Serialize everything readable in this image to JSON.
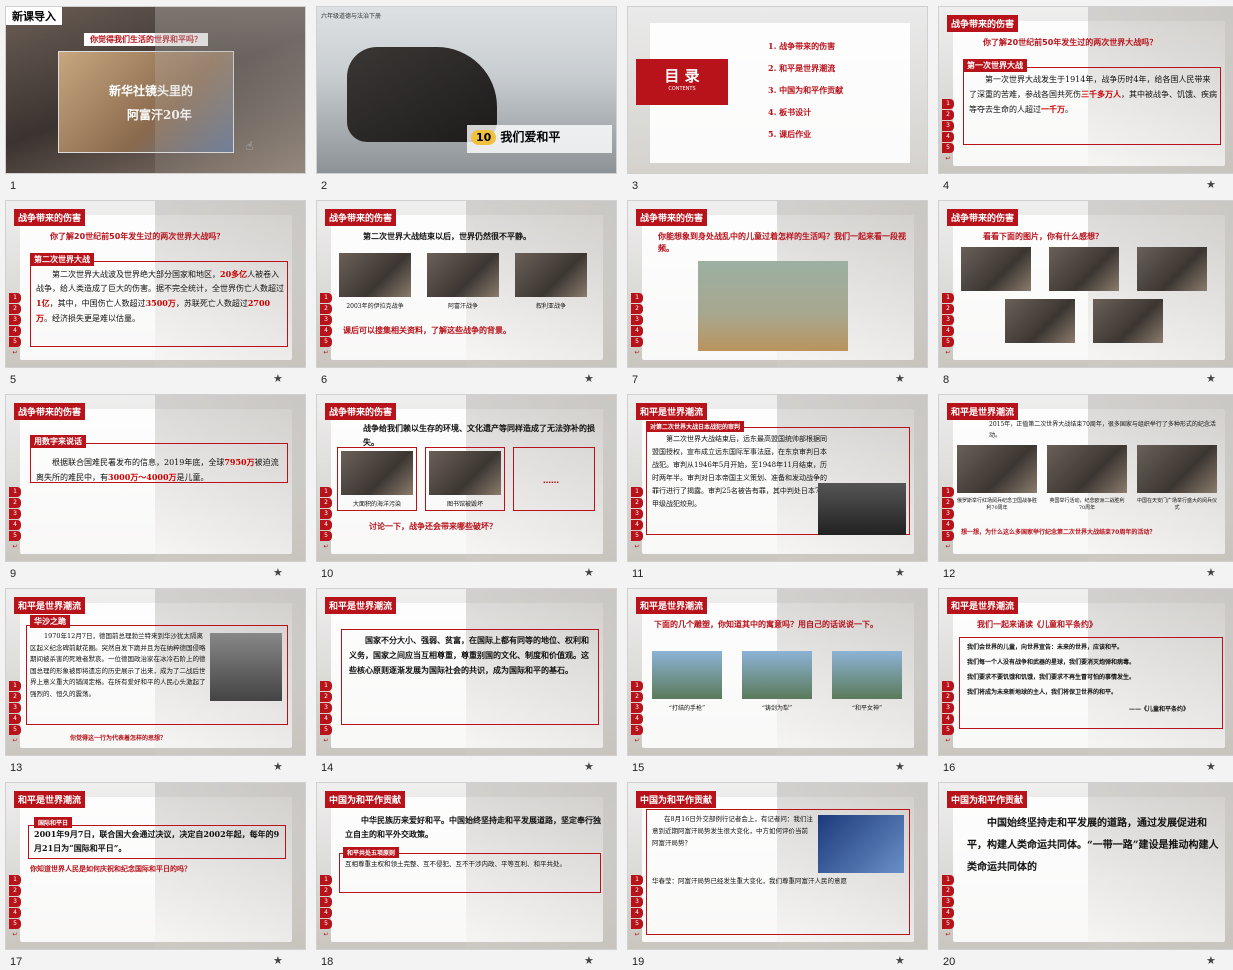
{
  "slides": [
    {
      "num": "1",
      "tag": "新课导入",
      "question": "你觉得我们生活的世界和平吗？",
      "video_line1": "新华社镜头里的",
      "video_line2": "阿富汗20年"
    },
    {
      "num": "2",
      "header": "六年级道德与法治下册",
      "lesson_no": "10",
      "lesson_title": "我们爱和平"
    },
    {
      "num": "3",
      "title": "目 录",
      "subtitle": "CONTENTS",
      "items": [
        "1. 战争带来的伤害",
        "2. 和平是世界潮流",
        "3. 中国为和平作贡献",
        "4. 板书设计",
        "5. 课后作业"
      ]
    },
    {
      "num": "4",
      "tag": "战争带来的伤害",
      "question": "你了解20世纪前50年发生过的两次世界大战吗？",
      "sub": "第一次世界大战",
      "text_a": "第一次世界大战发生于1914年，战争历时4年，给各国人民带来了深重的苦难，参战各国共死伤",
      "hl1": "三千多万人",
      "text_b": "，其中被战争、饥饿、疾病等夺去生命的人超过",
      "hl2": "一千万",
      "text_c": "。"
    },
    {
      "num": "5",
      "tag": "战争带来的伤害",
      "question": "你了解20世纪前50年发生过的两次世界大战吗？",
      "sub": "第二次世界大战",
      "text_a": "第二次世界大战波及世界绝大部分国家和地区，",
      "hl1": "20多亿",
      "text_b": "人被卷入战争，给人类造成了巨大的伤害。据不完全统计，全世界伤亡人数超过",
      "hl2": "1亿",
      "text_c": "，其中，中国伤亡人数超过",
      "hl3": "3500万",
      "text_d": "，苏联死亡人数超过",
      "hl4": "2700万",
      "text_e": "。经济损失更是难以估量。"
    },
    {
      "num": "6",
      "tag": "战争带来的伤害",
      "intro": "第二次世界大战结束以后，世界仍然很不平静。",
      "caps": [
        "2003年的伊拉克战争",
        "阿富汗战争",
        "叙利亚战争"
      ],
      "note": "课后可以搜集相关资料，了解这些战争的背景。"
    },
    {
      "num": "7",
      "tag": "战争带来的伤害",
      "question": "你能想象到身处战乱中的儿童过着怎样的生活吗？我们一起来看一段视频。"
    },
    {
      "num": "8",
      "tag": "战争带来的伤害",
      "question": "看看下面的图片，你有什么感想？"
    },
    {
      "num": "9",
      "tag": "战争带来的伤害",
      "sub": "用数字来说话",
      "text_a": "根据联合国难民署发布的信息，2019年底，全球",
      "hl1": "7950万",
      "text_b": "被迫流离失所的难民中，有",
      "hl2": "3000万～4000万",
      "text_c": "是儿童。"
    },
    {
      "num": "10",
      "tag": "战争带来的伤害",
      "intro": "战争给我们赖以生存的环境、文化遗产等同样造成了无法弥补的损失。",
      "caps": [
        "大面积的海洋污染",
        "图书馆被毁坏"
      ],
      "dots": "……",
      "question": "讨论一下，战争还会带来哪些破坏？"
    },
    {
      "num": "11",
      "tag": "和平是世界潮流",
      "sub": "对第二次世界大战日本战犯的审判",
      "text": "第二次世界大战结束后，远东最高盟国统帅部根据同盟国授权，宣布成立远东国际军事法庭，在东京审判日本战犯。审判从1946年5月开始，至1948年11月结束，历时两年半。审判对日本帝国主义策划、准备和发动战争的罪行进行了揭露。审判25名被告有罪，其中判处日本7名甲级战犯绞刑。"
    },
    {
      "num": "12",
      "tag": "和平是世界潮流",
      "intro": "2015年，正值第二次世界大战结束70周年，很多国家与组织举行了多种形式的纪念活动。",
      "caps": [
        "俄罗斯举行红场阅兵纪念卫国战争胜利70周年",
        "英国举行活动，纪念欧洲二战胜利70周年",
        "中国在天安门广场举行盛大的阅兵仪式"
      ],
      "question": "想一想，为什么这么多国家举行纪念第二次世界大战结束70周年的活动？"
    },
    {
      "num": "13",
      "tag": "和平是世界潮流",
      "sub": "华沙之跪",
      "text": "1970年12月7日，德国前总理勃兰特来到华沙犹太隔离区起义纪念碑前献花圈。突然自发下跪并且为在纳粹德国侵略期间被杀害的死难者默哀。一位德国政治家在冰冷石阶上的德国总理的形象被即将遗忘的历史展示了出来，成为了二战后世界上意义重大的铺阔定格。在所有爱好和平的人民心头激起了强烈的、恒久的震荡。",
      "question": "你觉得这一行为代表着怎样的思想？"
    },
    {
      "num": "14",
      "tag": "和平是世界潮流",
      "text": "国家不分大小、强弱、贫富，在国际上都有同等的地位、权利和义务，国家之间应当互相尊重，尊重别国的文化、制度和价值观。这些核心原则逐渐发展为国际社会的共识，成为国际和平的基石。"
    },
    {
      "num": "15",
      "tag": "和平是世界潮流",
      "question": "下面的几个雕塑，你知道其中的寓意吗？用自己的话说说一下。",
      "caps": [
        "“打结的手枪”",
        "“铸剑为犁”",
        "“和平女神”"
      ]
    },
    {
      "num": "16",
      "tag": "和平是世界潮流",
      "question": "我们一起来诵读《儿童和平条约》",
      "lines": [
        "我们会世界的儿童，向世界宣告：未来的世界，应该和平。",
        "我们每一个人没有战争和武器的星球，我们要消灭炮弹和病毒。",
        "我们要求不要饥饿和饥饿，我们要求不再生冒可怕的事情发生。",
        "我们将成为未来新地球的主人，我们将保卫世界的和平。"
      ],
      "source": "——《儿童和平条约》"
    },
    {
      "num": "17",
      "tag": "和平是世界潮流",
      "sub": "国际和平日",
      "text": "2001年9月7日，联合国大会通过决议，决定自2002年起，每年的9月21日为“国际和平日”。",
      "question": "你知道世界人民是如何庆祝和纪念国际和平日的吗？"
    },
    {
      "num": "18",
      "tag": "中国为和平作贡献",
      "text": "中华民族历来爱好和平。中国始终坚持走和平发展道路，坚定奉行独立自主的和平外交政策。",
      "sub": "和平共处五项原则",
      "text2": "互相尊重主权和领土完整、互不侵犯、互不干涉内政、平等互利、和平共处。"
    },
    {
      "num": "19",
      "tag": "中国为和平作贡献",
      "text": "在8月16日外交部例行记者会上，有记者问：我们注意到近期阿富汗局势发生很大变化，中方如何评价当前阿富汗局势？",
      "text2": "华春莹：阿富汗局势已经发生重大变化，我们尊重阿富汗人民的意愿"
    },
    {
      "num": "20",
      "tag": "中国为和平作贡献",
      "text": "中国始终坚持走和平发展的道路，通过发展促进和平，构建人类命运共同体。“一带一路”建设是推动构建人类命运共同体的"
    }
  ],
  "side_nav": [
    "1",
    "2",
    "3",
    "4",
    "5"
  ],
  "icons": {
    "star": "star-icon",
    "nav": "nav-arrow-icon"
  },
  "colors": {
    "accent": "#b8121b",
    "panel": "#ffffff"
  }
}
